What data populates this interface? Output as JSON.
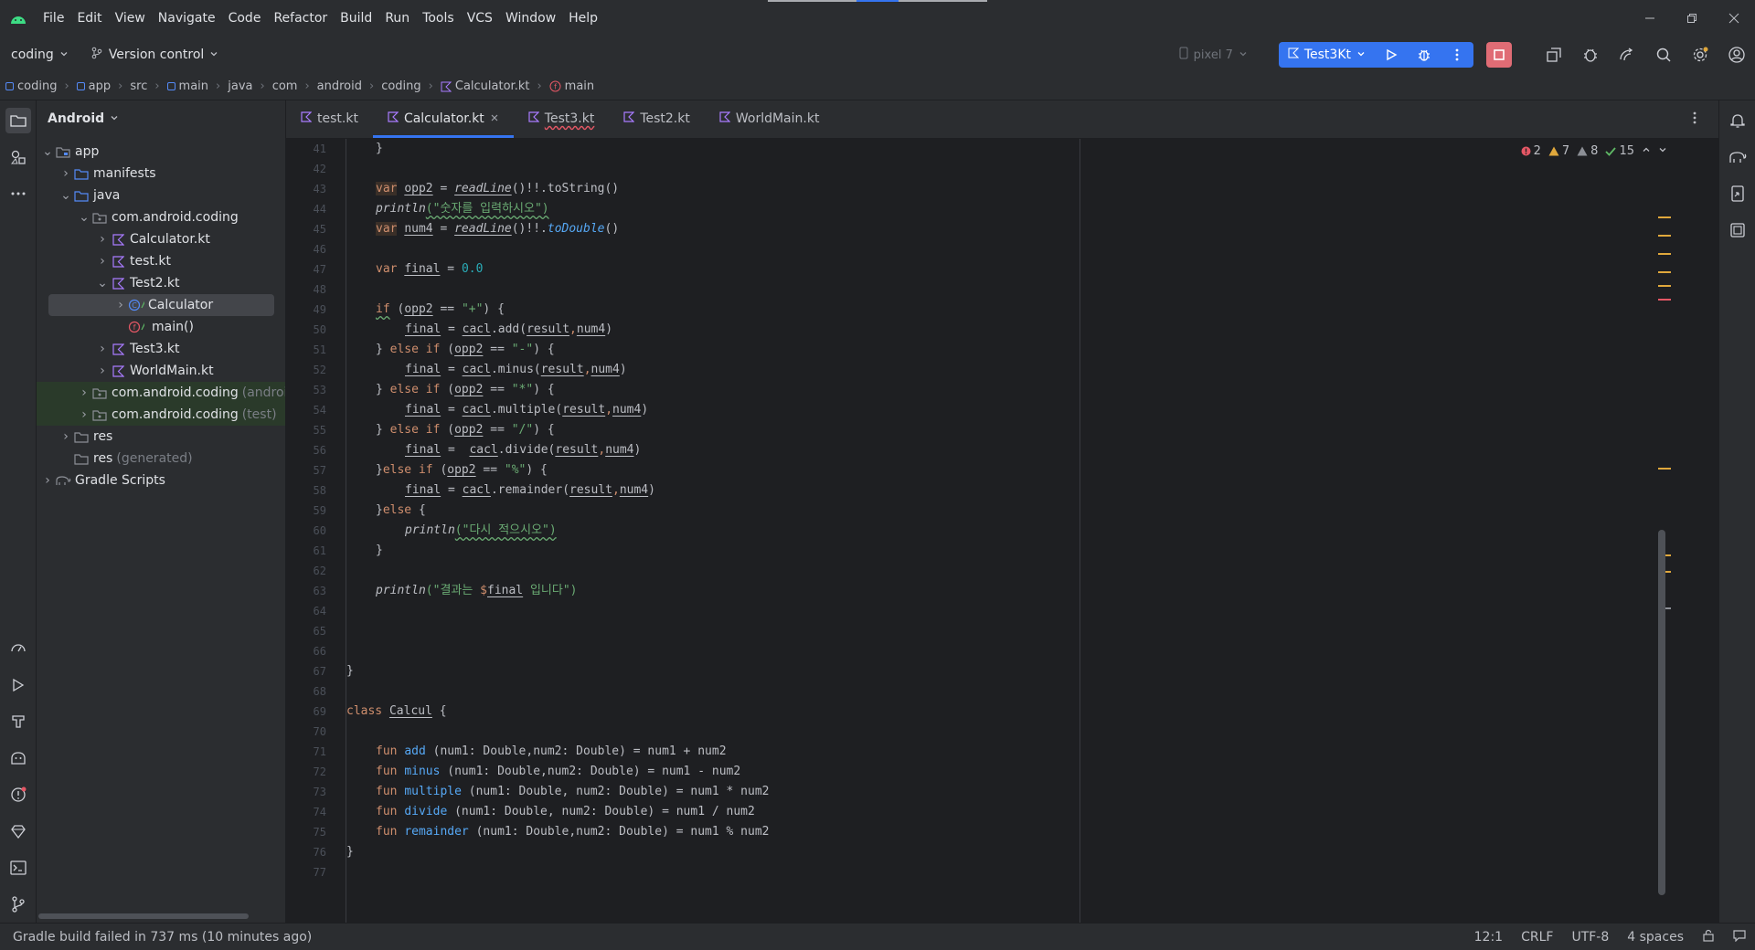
{
  "window": {
    "menu": [
      "File",
      "Edit",
      "View",
      "Navigate",
      "Code",
      "Refactor",
      "Build",
      "Run",
      "Tools",
      "VCS",
      "Window",
      "Help"
    ]
  },
  "toolbar": {
    "project_name": "coding",
    "vcs_label": "Version control",
    "device": "pixel 7",
    "run_config": "Test3Kt"
  },
  "breadcrumbs": [
    "coding",
    "app",
    "src",
    "main",
    "java",
    "com",
    "android",
    "coding",
    "Calculator.kt",
    "main"
  ],
  "project_panel": {
    "view_mode": "Android",
    "tree": {
      "app": "app",
      "manifests": "manifests",
      "java": "java",
      "pkg_main": "com.android.coding",
      "calculator_kt": "Calculator.kt",
      "test_kt": "test.kt",
      "test2_kt": "Test2.kt",
      "calculator_class": "Calculator",
      "main_fn": "main()",
      "test3_kt": "Test3.kt",
      "worldmain_kt": "WorldMain.kt",
      "pkg_android": "com.android.coding",
      "pkg_android_tag": "(androidTest)",
      "pkg_test": "com.android.coding",
      "pkg_test_tag": "(test)",
      "res": "res",
      "res_generated": "res",
      "res_generated_tag": "(generated)",
      "gradle": "Gradle Scripts"
    }
  },
  "editor": {
    "tabs": [
      "test.kt",
      "Calculator.kt",
      "Test3.kt",
      "Test2.kt",
      "WorldMain.kt"
    ],
    "active_tab": "Calculator.kt",
    "inspections": {
      "errors": "2",
      "warnings": "7",
      "weak_warnings": "8",
      "ok": "15"
    },
    "line_numbers": [
      "41",
      "42",
      "43",
      "44",
      "45",
      "46",
      "47",
      "48",
      "49",
      "50",
      "51",
      "52",
      "53",
      "54",
      "55",
      "56",
      "57",
      "58",
      "59",
      "60",
      "61",
      "62",
      "63",
      "64",
      "65",
      "66",
      "67",
      "68",
      "69",
      "70",
      "71",
      "72",
      "73",
      "74",
      "75",
      "76",
      "77"
    ],
    "code": {
      "l41": "}",
      "l43": {
        "kw": "var",
        "name": "opp2",
        "eq": " = ",
        "call": "readLine",
        "rest": "()!!.toString()"
      },
      "l44": {
        "fn": "println",
        "str": "(\"숫자를 입력하시오\")"
      },
      "l45": {
        "kw": "var",
        "name": "num4",
        "eq": " = ",
        "call": "readLine",
        "rest": "()!!.",
        "call2": "toDouble",
        "tail": "()"
      },
      "l47": {
        "kw": "var",
        "name": "final",
        "eq": " = ",
        "num": "0.0"
      },
      "l49": {
        "kw": "if",
        "a": " (",
        "name": "opp2",
        "b": " == ",
        "str": "\"+\"",
        "c": ") {"
      },
      "l50": {
        "name": "final",
        "a": " = ",
        "obj": "cacl",
        "b": ".add(",
        "p1": "result",
        "sep": ",",
        "p2": "num4",
        "c": ")"
      },
      "l51": {
        "a": "} ",
        "kw": "else if",
        "b": " (",
        "name": "opp2",
        "c": " == ",
        "str": "\"-\"",
        "d": ") {"
      },
      "l52": {
        "name": "final",
        "a": " = ",
        "obj": "cacl",
        "b": ".minus(",
        "p1": "result",
        "sep": ",",
        "p2": "num4",
        "c": ")"
      },
      "l53": {
        "a": "} ",
        "kw": "else if",
        "b": " (",
        "name": "opp2",
        "c": " == ",
        "str": "\"*\"",
        "d": ") {"
      },
      "l54": {
        "name": "final",
        "a": " = ",
        "obj": "cacl",
        "b": ".multiple(",
        "p1": "result",
        "sep": ",",
        "p2": "num4",
        "c": ")"
      },
      "l55": {
        "a": "} ",
        "kw": "else if",
        "b": " (",
        "name": "opp2",
        "c": " == ",
        "str": "\"/\"",
        "d": ") {"
      },
      "l56": {
        "name": "final",
        "a": " =  ",
        "obj": "cacl",
        "b": ".divide(",
        "p1": "result",
        "sep": ",",
        "p2": "num4",
        "c": ")"
      },
      "l57": {
        "a": "}",
        "kw": "else if",
        "b": " (",
        "name": "opp2",
        "c": " == ",
        "str": "\"%\"",
        "d": ") {"
      },
      "l58": {
        "name": "final",
        "a": " = ",
        "obj": "cacl",
        "b": ".remainder(",
        "p1": "result",
        "sep": ",",
        "p2": "num4",
        "c": ")"
      },
      "l59": {
        "a": "}",
        "kw": "else",
        "b": " {"
      },
      "l60": {
        "fn": "println",
        "str": "(\"다시 적으시오\")"
      },
      "l61": "}",
      "l63": {
        "fn": "println",
        "s1": "(\"결과는 ",
        "tpl": "$",
        "name": "final",
        "s2": " 입니다\")"
      },
      "l67": "}",
      "l69": {
        "kw": "class",
        "name": "Calcul",
        "rest": " {"
      },
      "l71": {
        "kw": "fun",
        "fn": "add",
        "rest": " (num1: Double,num2: Double) = num1 + num2"
      },
      "l72": {
        "kw": "fun",
        "fn": "minus",
        "rest": " (num1: Double,num2: Double) = num1 - num2"
      },
      "l73": {
        "kw": "fun",
        "fn": "multiple",
        "rest": " (num1: Double, num2: Double) = num1 * num2"
      },
      "l74": {
        "kw": "fun",
        "fn": "divide",
        "rest": " (num1: Double, num2: Double) = num1 / num2"
      },
      "l75": {
        "kw": "fun",
        "fn": "remainder",
        "rest": " (num1: Double,num2: Double) = num1 % num2"
      },
      "l76": "}"
    }
  },
  "statusbar": {
    "message": "Gradle build failed in 737 ms (10 minutes ago)",
    "position": "12:1",
    "line_sep": "CRLF",
    "encoding": "UTF-8",
    "indent": "4 spaces"
  },
  "colors": {
    "accent": "#3574f0",
    "stop": "#e06c75",
    "error": "#e55765",
    "warning": "#e0a83c",
    "ok": "#5fb865"
  }
}
